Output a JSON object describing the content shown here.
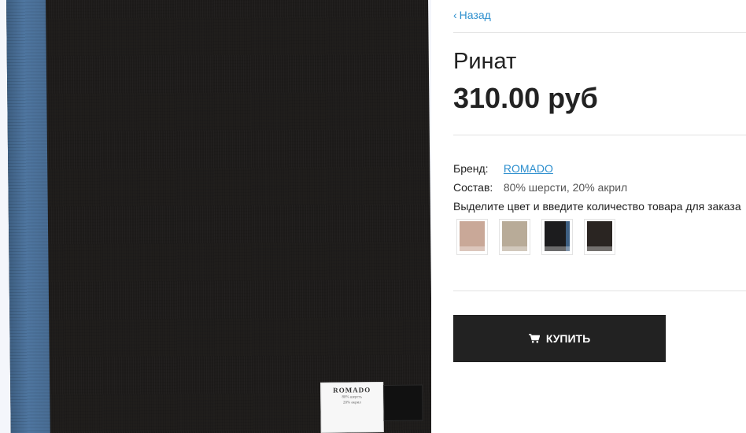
{
  "nav": {
    "back_label": "Назад"
  },
  "product": {
    "title": "Ринат",
    "price": "310.00 руб",
    "attributes": [
      {
        "label": "Бренд:",
        "value": "ROMADO"
      },
      {
        "label": "Состав:",
        "value": "80% шерсти, 20% акрил"
      }
    ],
    "select_hint": "Выделите цвет и введите количество товара для заказа",
    "swatches": [
      {
        "name": "beige",
        "color": "#c9a898"
      },
      {
        "name": "grey",
        "color": "#b8ab98"
      },
      {
        "name": "black-blue",
        "color": "#1c1c1e",
        "accent": "#3e5f82"
      },
      {
        "name": "dark-brown",
        "color": "#2a2522"
      }
    ]
  },
  "actions": {
    "buy_label": "КУПИТЬ"
  },
  "image": {
    "tag_brand": "ROMADO",
    "tag_lines": [
      "80% шерсть",
      "20% акрил"
    ]
  },
  "colors": {
    "link": "#2d8fce",
    "button_bg": "#222222"
  }
}
